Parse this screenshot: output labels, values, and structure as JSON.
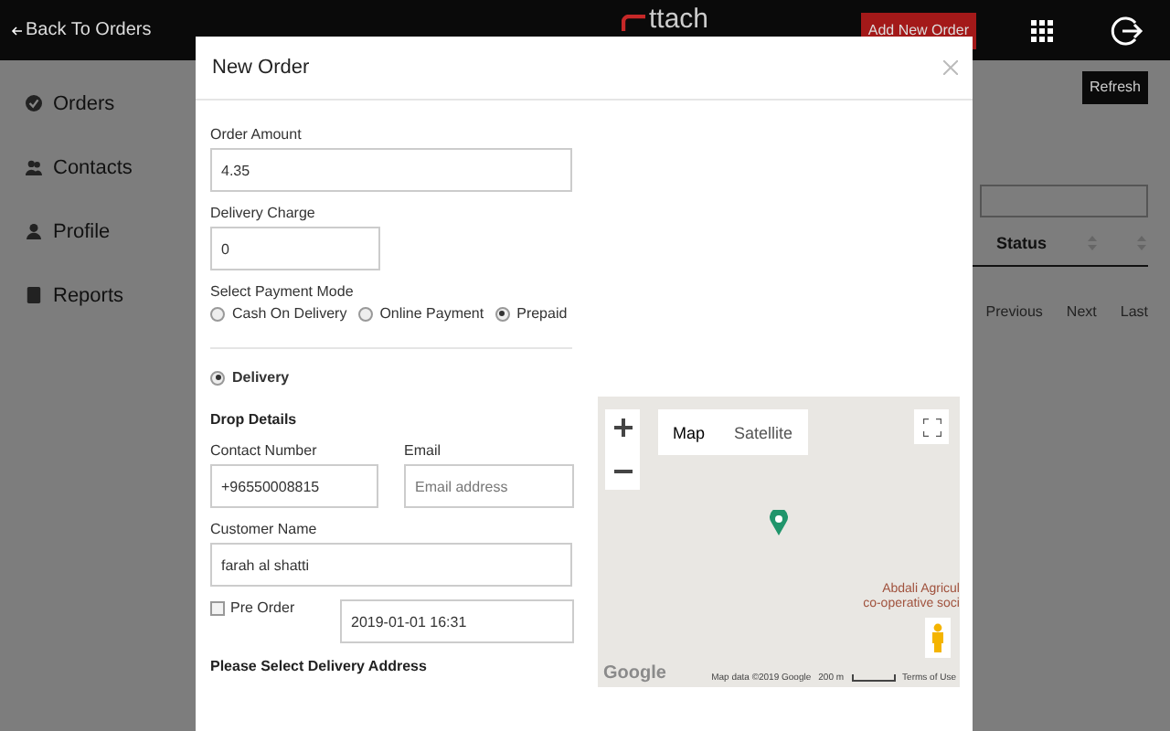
{
  "topbar": {
    "back_link": "Back To Orders",
    "logo": "ttach",
    "add_button": "Add New Order"
  },
  "sidebar": {
    "items": [
      {
        "label": "Orders"
      },
      {
        "label": "Contacts"
      },
      {
        "label": "Profile"
      },
      {
        "label": "Reports"
      }
    ]
  },
  "background": {
    "refresh_button": "Refresh",
    "column": "Status",
    "pager": [
      "Previous",
      "Next",
      "Last"
    ]
  },
  "modal": {
    "title": "New Order",
    "order_amount": {
      "label": "Order Amount",
      "value": "4.35"
    },
    "delivery_charge": {
      "label": "Delivery Charge",
      "value": "0"
    },
    "payment_mode": {
      "label": "Select Payment Mode",
      "options": [
        {
          "label": "Cash On Delivery",
          "selected": false
        },
        {
          "label": "Online Payment",
          "selected": false
        },
        {
          "label": "Prepaid",
          "selected": true
        }
      ]
    },
    "delivery": {
      "label": "Delivery",
      "selected": true
    },
    "drop_heading": "Drop Details",
    "contact_number": {
      "label": "Contact Number",
      "value": "+96550008815"
    },
    "email": {
      "label": "Email",
      "placeholder": "Email address"
    },
    "customer_name": {
      "label": "Customer Name",
      "value": "farah al shatti"
    },
    "pre_order": {
      "label": "Pre Order",
      "checked": false,
      "value": "2019-01-01 16:31"
    },
    "address_heading": "Please Select Delivery Address",
    "map": {
      "types": [
        {
          "label": "Map",
          "selected": true
        },
        {
          "label": "Satellite",
          "selected": false
        }
      ],
      "place_lines": [
        "Abdali Agricul",
        "co-operative soci"
      ],
      "brand": "Google",
      "attribution": "Map data ©2019 Google",
      "scale": "200 m",
      "terms": "Terms of Use"
    }
  }
}
